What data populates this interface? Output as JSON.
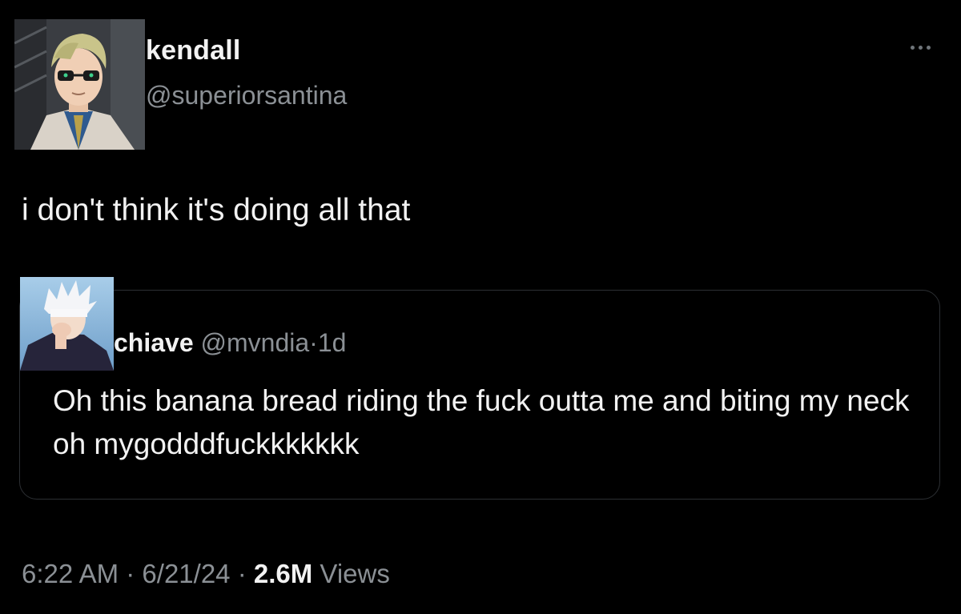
{
  "tweet": {
    "author": {
      "display_name": "kendall",
      "handle": "@superiorsantina"
    },
    "text": "i don't think it's doing all that",
    "quoted": {
      "display_name": "chiave",
      "handle": "@mvndia",
      "separator": "·",
      "age": "1d",
      "text": "Oh this banana bread riding the fuck outta me and biting my neck oh mygodddfuckkkkkkk"
    },
    "meta": {
      "time": "6:22 AM",
      "separator": "·",
      "date": "6/21/24",
      "separator2": "·",
      "views_count": "2.6M",
      "views_label": "Views"
    }
  },
  "icons": {
    "more": "more-horizontal-icon"
  },
  "colors": {
    "background": "#000000",
    "primary_text": "#f2f2f2",
    "secondary_text": "#8b9095",
    "card_border": "#2c2f33"
  }
}
